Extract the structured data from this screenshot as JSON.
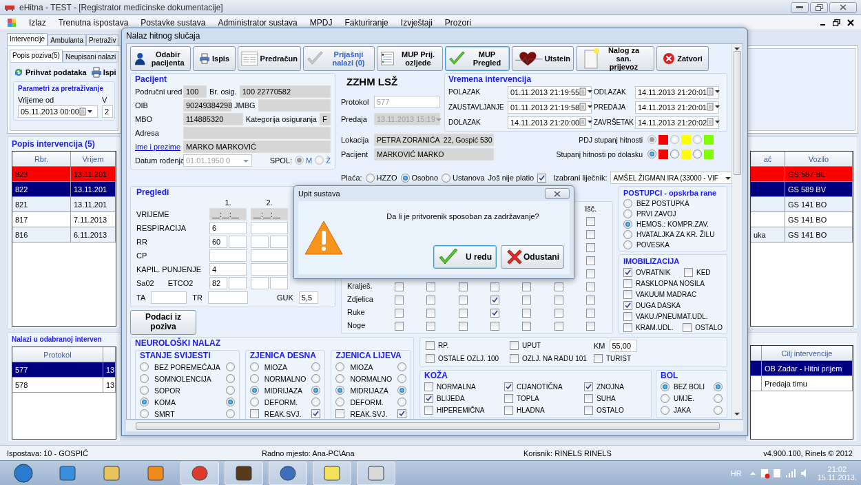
{
  "app_window": {
    "title": "eHitna - TEST - [Registrator medicinske dokumentacije]"
  },
  "menu": [
    "Izlaz",
    "Trenutna ispostava",
    "Postavke sustava",
    "Administrator sustava",
    "MPDJ",
    "Fakturiranje",
    "Izvještaji",
    "Prozori"
  ],
  "main_tabs": [
    {
      "label": "Intervencije",
      "selected": true
    },
    {
      "label": "Ambulanta",
      "selected": false
    },
    {
      "label": "Pretraživ",
      "selected": false
    }
  ],
  "sub_tabs": [
    {
      "label": "Popis poziva(5)",
      "selected": true
    },
    {
      "label": "Neupisani nalazi",
      "selected": false
    }
  ],
  "toolbar": [
    {
      "label": "Prihvat podataka"
    },
    {
      "label": "Ispi"
    }
  ],
  "search_params": {
    "title": "Parametri za pretraživanje",
    "fields": [
      {
        "label": "Vrijeme od",
        "value": "05.11.2013 00:00"
      },
      {
        "label": "V",
        "value": "2"
      }
    ]
  },
  "interventions": {
    "title": "Popis intervencija (5)",
    "columns": [
      "Rbr.",
      "Vrijem"
    ],
    "right_columns": [
      "ač",
      "Vozilo"
    ],
    "rows": [
      {
        "rbr": "823",
        "time": "13.11.201",
        "vehicle": "GS 587 BL",
        "kind": "urgent",
        "selected": false
      },
      {
        "rbr": "822",
        "time": "13.11.201",
        "vehicle": "GS 589 BV",
        "kind": "normal",
        "selected": true
      },
      {
        "rbr": "821",
        "time": "13.11.201",
        "vehicle": "GS 141 BO",
        "kind": "normal",
        "selected": false
      },
      {
        "rbr": "817",
        "time": "7.11.2013",
        "vehicle": "GS 141 BO",
        "kind": "normal",
        "selected": false
      },
      {
        "rbr": "816",
        "time": "6.11.2013",
        "column_3": "uka",
        "vehicle": "GS 141 BO",
        "kind": "normal",
        "selected": false
      }
    ]
  },
  "findings": {
    "title": "Nalazi u odabranoj interven",
    "columns": [
      "Protokol"
    ],
    "right_columns": [
      "Cilj intervencije"
    ],
    "rows": [
      {
        "protocol": "577",
        "column_2": "13",
        "goal": "OB Zadar - Hitni prijem",
        "selected": true
      },
      {
        "protocol": "578",
        "column_2": "13",
        "goal": "Predaja timu",
        "selected": false
      }
    ]
  },
  "status_bar": [
    "Ispostava: 10 - GOSPIĆ",
    "Radno mjesto: Ana-PC\\Ana",
    "Korisnik: RINELS RINELS",
    "v4.900.100, Rinels © 2012"
  ],
  "taskbar": {
    "language": "HR",
    "time": "21:02",
    "date": "15.11.2013."
  },
  "dialog": {
    "title": "Nalaz hitnog slučaja",
    "toolbar": [
      {
        "label": "Odabir pacijenta",
        "disabled": false,
        "selected": false
      },
      {
        "label": "Ispis",
        "disabled": false,
        "selected": false
      },
      {
        "label": "Predračun",
        "disabled": false,
        "selected": false
      },
      {
        "label": "Prijašnji nalazi (0)",
        "disabled": true,
        "selected": false
      },
      {
        "label": "MUP Prij. ozljede",
        "disabled": false,
        "selected": false
      },
      {
        "label": "MUP Pregled",
        "disabled": false,
        "selected": true
      },
      {
        "label": "Utstein",
        "disabled": false,
        "selected": false
      },
      {
        "label": "Nalog za san. prijevoz",
        "disabled": false,
        "selected": false
      },
      {
        "label": "Zatvori",
        "disabled": false,
        "selected": false
      }
    ],
    "patient": {
      "title": "Pacijent",
      "rows": [
        {
          "fields": [
            {
              "label": "Područni ured",
              "value": "100",
              "kind": "readonly"
            },
            {
              "label": "Br. osig.",
              "value": "100 22770582",
              "kind": "readonly"
            }
          ]
        },
        {
          "fields": [
            {
              "label": "OIB",
              "value": "90249384298",
              "kind": "readonly"
            },
            {
              "label": "JMBG",
              "kind": "readonly"
            }
          ]
        },
        {
          "fields": [
            {
              "label": "MBO",
              "value": "114885320",
              "kind": "readonly"
            },
            {
              "label": "Kategorija osiguranja",
              "value": "F",
              "kind": "readonly"
            }
          ]
        },
        {
          "fields": [
            {
              "label": "Adresa",
              "kind": "readonly"
            }
          ]
        },
        {
          "fields": [
            {
              "label": "Ime i prezime",
              "value": "MARKO MARKOVIĆ",
              "kind": "link"
            }
          ]
        },
        {
          "fields": [
            {
              "label": "Datum rođenja",
              "value": "01.01.1950 0",
              "kind": "dropdown"
            }
          ]
        }
      ],
      "sex": {
        "label": "SPOL:",
        "options": [
          {
            "label": "M",
            "selected": true
          },
          {
            "label": "Ž",
            "selected": false
          }
        ]
      }
    },
    "unit": {
      "name": "ZZHM LSŽ",
      "fields": [
        {
          "label": "Protokol",
          "value": "577",
          "kind": "disabled"
        },
        {
          "label": "Predaja",
          "value": "13.11.2013 15:19",
          "kind": "dropdown"
        },
        {
          "label": "Lokacija",
          "value": "PETRA ZORANIĆA  22, Gospić 530",
          "kind": "readonly"
        },
        {
          "label": "Pacijent",
          "value": "MARKOVIĆ MARKO",
          "kind": "readonly"
        }
      ]
    },
    "times": {
      "title": "Vremena intervencija",
      "items": [
        {
          "label": "POLAZAK",
          "value": "01.11.2013 21:19:55"
        },
        {
          "label": "ODLAZAK",
          "value": "14.11.2013 21:20:01"
        },
        {
          "label": "ZAUSTAVLJANJE",
          "value": "01.11.2013 21:19:58"
        },
        {
          "label": "PREDAJA",
          "value": "14.11.2013 21:20:01"
        },
        {
          "label": "DOLAZAK",
          "value": "14.11.2013 21:20:00"
        },
        {
          "label": "ZAVRŠETAK",
          "value": "14.11.2013 21:20:02"
        }
      ]
    },
    "urgency": [
      {
        "label": "PDJ stupanj hitnosti",
        "disabled": true,
        "options": [
          {
            "color": "#ff0000",
            "selected": true
          },
          {
            "color": "#ffff00",
            "selected": false
          },
          {
            "color": "#80ff00",
            "selected": false
          }
        ]
      },
      {
        "label": "Stupanj hitnosti po dolasku",
        "disabled": false,
        "options": [
          {
            "color": "#ff0000",
            "selected": true
          },
          {
            "color": "#ffff00",
            "selected": false
          },
          {
            "color": "#80ff00",
            "selected": false
          }
        ]
      }
    ],
    "payment": {
      "label": "Plaća:",
      "options": [
        {
          "label": "HZZO",
          "selected": false
        },
        {
          "label": "Osobno",
          "selected": true
        },
        {
          "label": "Ustanova",
          "selected": false
        }
      ],
      "unpaid": {
        "label": "Još nije platio",
        "checked": true
      },
      "doctor": {
        "label": "Izabrani liječnik:",
        "value": "AMŠEL ŽIGMAN IRA (33000 - VIF"
      }
    },
    "exams": {
      "title": "Pregledi",
      "columns": [
        "1.",
        "2."
      ],
      "rows": [
        {
          "label": "VRIJEME",
          "kind": "time",
          "values": [
            "__:__:__",
            "__:__:__"
          ]
        },
        {
          "label": "RESPIRACIJA",
          "kind": "single",
          "values": [
            "6"
          ]
        },
        {
          "label": "RR",
          "kind": "pair",
          "values": [
            "60"
          ]
        },
        {
          "label": "CP",
          "kind": "single",
          "values": []
        },
        {
          "label": "KAPIL. PUNJENJE",
          "kind": "single",
          "values": [
            "4"
          ]
        },
        {
          "label": "Sa02",
          "label_2": "ETCO2",
          "kind": "pair",
          "values": [
            "82"
          ]
        }
      ],
      "footer": [
        {
          "label": "TA"
        },
        {
          "label": "TR"
        },
        {
          "label": "GUK",
          "value": "5,5"
        }
      ]
    },
    "data_button": "Podaci iz poziva",
    "injuries": {
      "last_header": "Išč.",
      "rows": [
        {
          "checks": [
            false
          ]
        },
        {
          "checks": [
            false
          ]
        },
        {
          "checks": [
            false
          ]
        },
        {
          "checks": [
            false
          ]
        },
        {
          "checks": [
            false
          ]
        },
        {
          "label": "Kralješ.",
          "checks": [
            false,
            false,
            false,
            false,
            false,
            false,
            false
          ]
        },
        {
          "label": "Zdjelica",
          "checks": [
            false,
            false,
            false,
            true,
            false,
            false,
            false
          ]
        },
        {
          "label": "Ruke",
          "checks": [
            false,
            false,
            false,
            true,
            false,
            false,
            false
          ]
        },
        {
          "label": "Noge",
          "checks": [
            false,
            false,
            false,
            false,
            false,
            false,
            false
          ]
        }
      ]
    },
    "procedures": {
      "title": "POSTUPCI - opskrba rane",
      "options": [
        {
          "label": "BEZ POSTUPKA",
          "selected": false
        },
        {
          "label": "PRVI ZAVOJ",
          "selected": false
        },
        {
          "label": "HEMOS.: KOMPR.ZAV.",
          "selected": true
        },
        {
          "label": "HVATALJKA ZA KR. ŽILU",
          "selected": false
        },
        {
          "label": "POVESKA",
          "selected": false
        }
      ]
    },
    "immobilization": {
      "title": "IMOBILIZACIJA",
      "rows": [
        {
          "items": [
            {
              "label": "OVRATNIK",
              "checked": true
            },
            {
              "label": "KED",
              "checked": false
            }
          ]
        },
        {
          "items": [
            {
              "label": "RASKLOPNA NOSILA",
              "checked": false
            }
          ]
        },
        {
          "items": [
            {
              "label": "VAKUUM MADRAC",
              "checked": false
            }
          ]
        },
        {
          "items": [
            {
              "label": "DUGA DASKA",
              "checked": true
            }
          ]
        },
        {
          "items": [
            {
              "label": "VAKU./PNEUMAT.UDL.",
              "checked": false
            }
          ]
        },
        {
          "items": [
            {
              "label": "KRAM.UDL.",
              "checked": false
            },
            {
              "label": "OSTALO",
              "checked": false
            }
          ]
        }
      ]
    },
    "neuro": {
      "title": "NEUROLOŠKI NALAZ",
      "groups": [
        {
          "title": "STANJE SVIJESTI",
          "items": [
            {
              "label": "BEZ POREMEĆAJA",
              "kind": "radio",
              "left": false,
              "right": false
            },
            {
              "label": "SOMNOLENCIJA",
              "kind": "radio",
              "left": false,
              "right": false
            },
            {
              "label": "SOPOR",
              "kind": "radio",
              "left": false,
              "right": false
            },
            {
              "label": "KOMA",
              "kind": "radio",
              "left": true,
              "right": true
            },
            {
              "label": "SMRT",
              "kind": "radio",
              "left": false,
              "right": false
            }
          ]
        },
        {
          "title": "ZJENICA DESNA",
          "items": [
            {
              "label": "MIOZA",
              "kind": "radio",
              "left": false,
              "right": false
            },
            {
              "label": "NORMALNO",
              "kind": "radio",
              "left": false,
              "right": false
            },
            {
              "label": "MIDRIJAZA",
              "kind": "radio",
              "left": true,
              "right": true
            },
            {
              "label": "DEFORM.",
              "kind": "radio",
              "left": false,
              "right": false
            },
            {
              "label": "REAK.SVJ.",
              "kind": "check",
              "left": false,
              "right": true
            }
          ]
        },
        {
          "title": "ZJENICA LIJEVA",
          "items": [
            {
              "label": "MIOZA",
              "kind": "radio",
              "left": false,
              "right": false
            },
            {
              "label": "NORMALNO",
              "kind": "radio",
              "left": false,
              "right": false
            },
            {
              "label": "MIDRIJAZA",
              "kind": "radio",
              "left": true,
              "right": true
            },
            {
              "label": "DEFORM.",
              "kind": "radio",
              "left": false,
              "right": false
            },
            {
              "label": "REAK.SVJ.",
              "kind": "check",
              "left": false,
              "right": true
            }
          ]
        }
      ]
    },
    "other": [
      {
        "label": "RP.",
        "kind": "check",
        "checked": false
      },
      {
        "label": "UPUT",
        "kind": "check",
        "checked": false
      },
      {
        "label": "KM",
        "kind": "field",
        "value": "55,00"
      },
      {
        "label": "OSTALE OZLJ. 100",
        "kind": "check",
        "checked": false
      },
      {
        "label": "OZLJ. NA RADU 101",
        "kind": "check",
        "checked": false
      },
      {
        "label": "TURIST",
        "kind": "check",
        "checked": false
      }
    ],
    "skin": {
      "title": "KOŽA",
      "items": [
        {
          "label": "NORMALNA",
          "checked": false
        },
        {
          "label": "CIJANOTIČNA",
          "checked": true
        },
        {
          "label": "ZNOJNA",
          "checked": true
        },
        {
          "label": "BLIJEDA",
          "checked": true
        },
        {
          "label": "TOPLA",
          "checked": false
        },
        {
          "label": "SUHA",
          "checked": false
        },
        {
          "label": "HIPEREMIČNA",
          "checked": false
        },
        {
          "label": "HLADNA",
          "checked": false
        },
        {
          "label": "OSTALO",
          "checked": false
        }
      ]
    },
    "pain": {
      "title": "BOL",
      "items": [
        {
          "label": "BEZ BOLI",
          "left": true,
          "right": true
        },
        {
          "label": "UMJE.",
          "left": false,
          "right": false
        },
        {
          "label": "JAKA",
          "left": false,
          "right": false
        }
      ]
    }
  },
  "message_box": {
    "title": "Upit sustava",
    "message": "Da li je pritvorenik sposoban za zadržavanje?",
    "buttons": [
      {
        "label": "U redu",
        "selected": true
      },
      {
        "label": "Odustani",
        "selected": false
      }
    ]
  }
}
